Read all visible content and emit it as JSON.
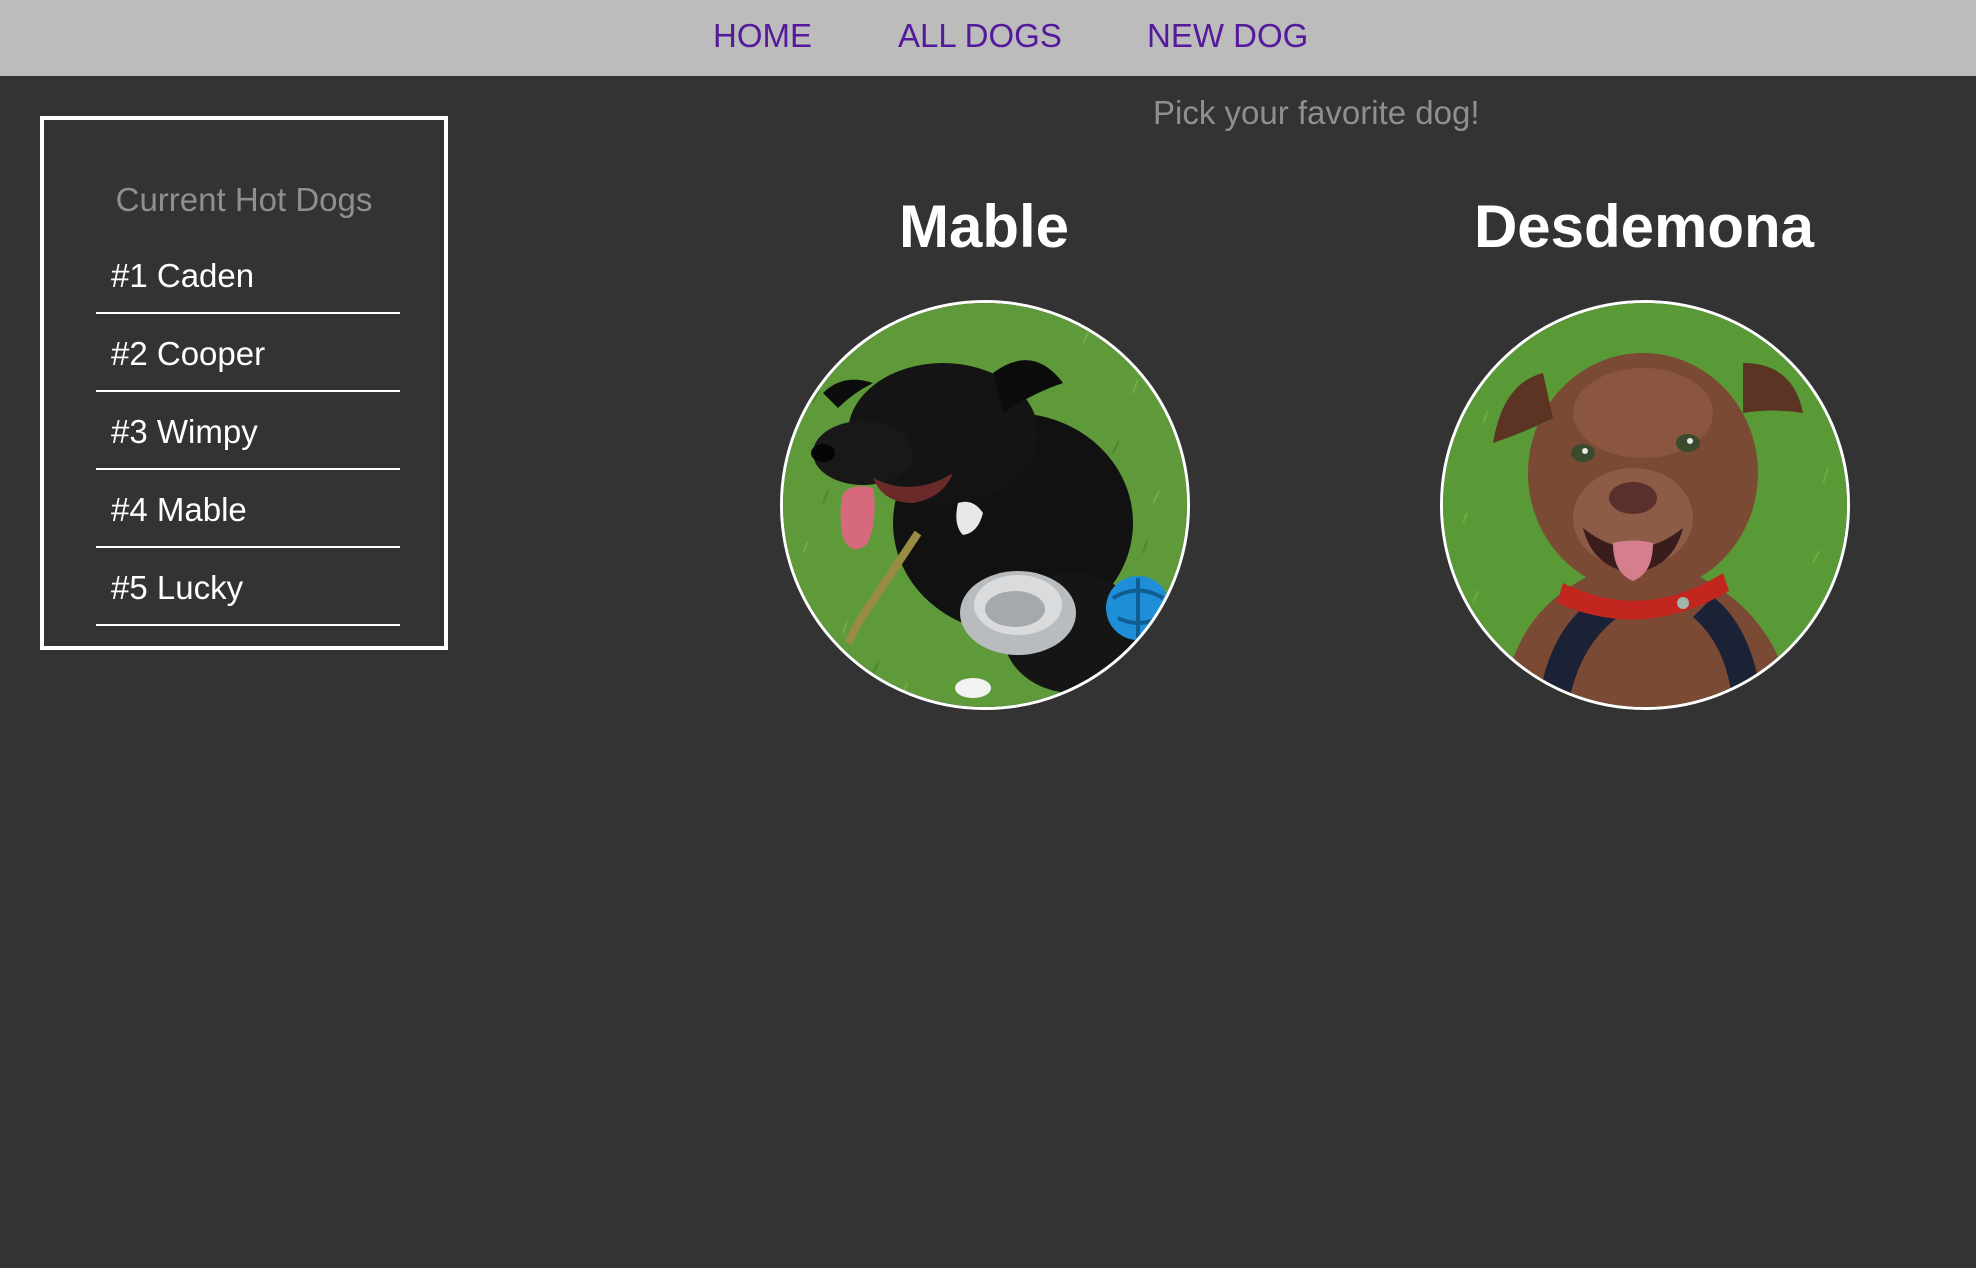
{
  "nav": {
    "links": [
      {
        "label": "HOME"
      },
      {
        "label": "ALL DOGS"
      },
      {
        "label": "NEW DOG"
      }
    ],
    "link_color": "#55199b",
    "bar_color": "#bcbcbc"
  },
  "tagline": "Pick your favorite dog!",
  "sidebar": {
    "title": "Current Hot Dogs",
    "items": [
      {
        "label": "#1 Caden"
      },
      {
        "label": "#2 Cooper"
      },
      {
        "label": "#3 Wimpy"
      },
      {
        "label": "#4 Mable"
      },
      {
        "label": "#5 Lucky"
      }
    ]
  },
  "dogs": [
    {
      "name": "Mable",
      "photo": "black-dog-on-grass-with-bowl"
    },
    {
      "name": "Desdemona",
      "photo": "brown-dog-smiling-on-grass"
    }
  ],
  "colors": {
    "background": "#333333",
    "text": "#ffffff",
    "muted": "#8f8f8f"
  }
}
